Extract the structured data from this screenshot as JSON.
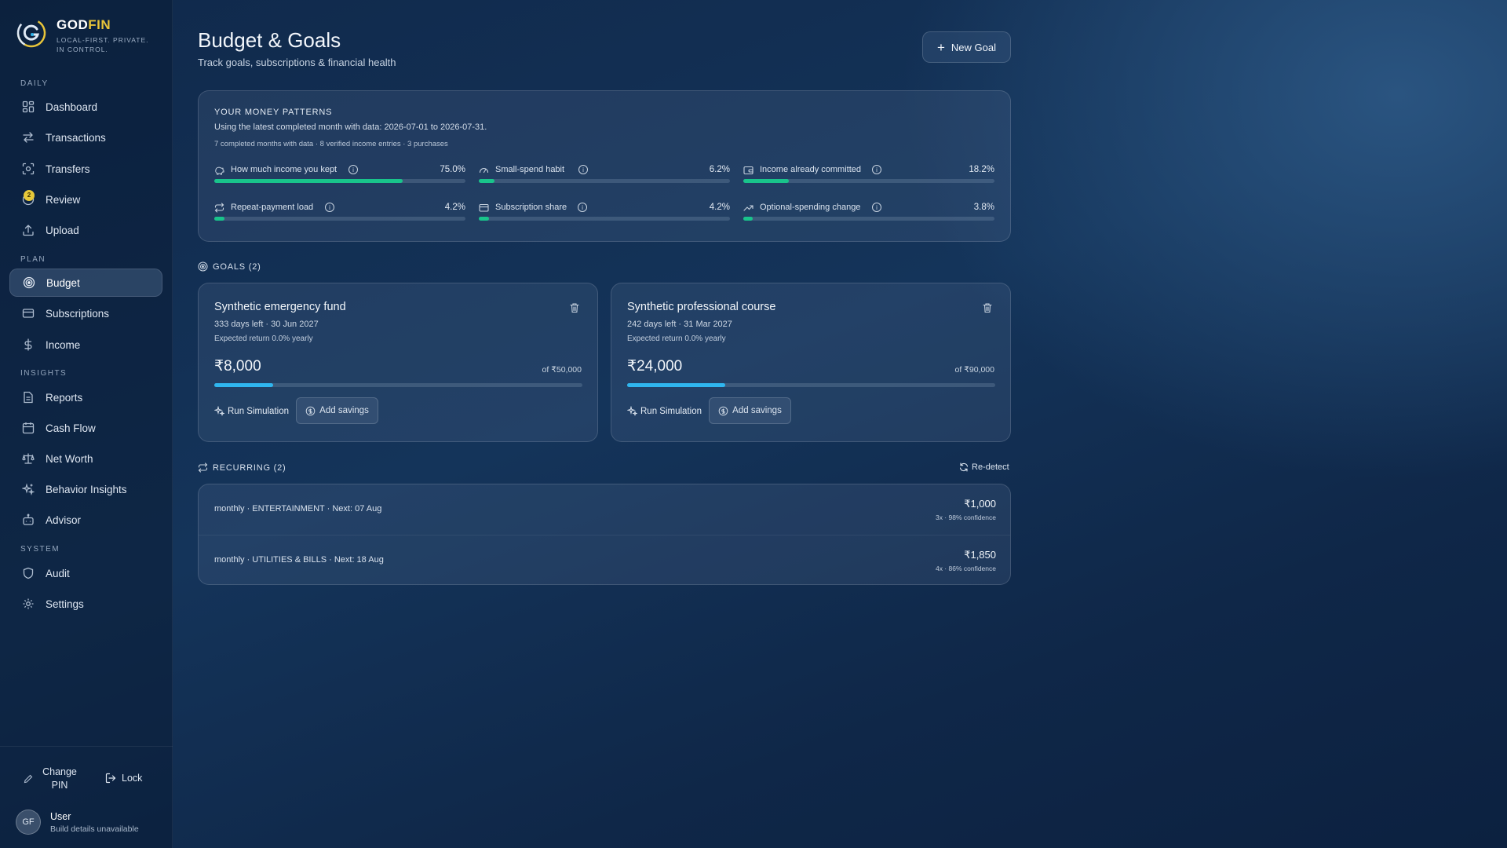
{
  "brand": {
    "name_main": "GOD",
    "name_accent": "FIN",
    "tagline": "LOCAL-FIRST. PRIVATE. IN CONTROL."
  },
  "sidebar": {
    "sections": {
      "daily": "DAILY",
      "plan": "PLAN",
      "insights": "INSIGHTS",
      "system": "SYSTEM"
    },
    "items": [
      {
        "label": "Dashboard",
        "icon": "dashboard-icon"
      },
      {
        "label": "Transactions",
        "icon": "arrows-icon"
      },
      {
        "label": "Transfers",
        "icon": "transfer-icon"
      },
      {
        "label": "Review",
        "icon": "review-icon",
        "badge": "2"
      },
      {
        "label": "Upload",
        "icon": "upload-icon"
      },
      {
        "label": "Budget",
        "icon": "target-icon",
        "active": true
      },
      {
        "label": "Subscriptions",
        "icon": "card-icon"
      },
      {
        "label": "Income",
        "icon": "dollar-icon"
      },
      {
        "label": "Reports",
        "icon": "file-icon"
      },
      {
        "label": "Cash Flow",
        "icon": "calendar-icon"
      },
      {
        "label": "Net Worth",
        "icon": "scale-icon"
      },
      {
        "label": "Behavior Insights",
        "icon": "sparkle-icon"
      },
      {
        "label": "Advisor",
        "icon": "bot-icon"
      },
      {
        "label": "Audit",
        "icon": "shield-icon"
      },
      {
        "label": "Settings",
        "icon": "gear-icon"
      }
    ],
    "footer": {
      "change_pin": "Change PIN",
      "lock": "Lock",
      "avatar_initials": "GF",
      "user_name": "User",
      "build": "Build details unavailable"
    }
  },
  "header": {
    "title": "Budget & Goals",
    "subtitle": "Track goals, subscriptions & financial health",
    "new_goal_label": "New Goal"
  },
  "patterns": {
    "heading": "YOUR MONEY PATTERNS",
    "range": "Using the latest completed month with data: 2026-07-01 to 2026-07-31.",
    "meta": "7 completed months with data · 8 verified income entries · 3 purchases",
    "metrics": [
      {
        "label": "How much income you kept",
        "value": "75.0%",
        "fraction": 0.75,
        "icon": "piggy-icon"
      },
      {
        "label": "Small-spend habit",
        "value": "6.2%",
        "fraction": 0.062,
        "icon": "gauge-icon"
      },
      {
        "label": "Income already committed",
        "value": "18.2%",
        "fraction": 0.182,
        "icon": "wallet-icon"
      },
      {
        "label": "Repeat-payment load",
        "value": "4.2%",
        "fraction": 0.042,
        "icon": "repeat-icon"
      },
      {
        "label": "Subscription share",
        "value": "4.2%",
        "fraction": 0.042,
        "icon": "card-icon"
      },
      {
        "label": "Optional-spending change",
        "value": "3.8%",
        "fraction": 0.038,
        "icon": "trend-icon"
      }
    ]
  },
  "goals": {
    "heading": "GOALS (2)",
    "items": [
      {
        "title": "Synthetic emergency fund",
        "days": "333 days left · 30 Jun 2027",
        "return": "Expected return 0.0% yearly",
        "amount": "₹8,000",
        "target": "of ₹50,000",
        "progress": 0.16,
        "run_label": "Run Simulation",
        "add_label": "Add savings"
      },
      {
        "title": "Synthetic professional course",
        "days": "242 days left · 31 Mar 2027",
        "return": "Expected return 0.0% yearly",
        "amount": "₹24,000",
        "target": "of ₹90,000",
        "progress": 0.267,
        "run_label": "Run Simulation",
        "add_label": "Add savings"
      }
    ]
  },
  "recurring": {
    "heading": "RECURRING (2)",
    "redetect_label": "Re-detect",
    "items": [
      {
        "desc": "monthly · ENTERTAINMENT · Next: 07 Aug",
        "amount": "₹1,000",
        "confidence": "3x · 98% confidence"
      },
      {
        "desc": "monthly · UTILITIES & BILLS · Next: 18 Aug",
        "amount": "₹1,850",
        "confidence": "4x · 86% confidence"
      }
    ]
  },
  "colors": {
    "accent_green": "#19c48b",
    "accent_blue": "#2fb6ef",
    "brand_yellow": "#e8c53a"
  }
}
